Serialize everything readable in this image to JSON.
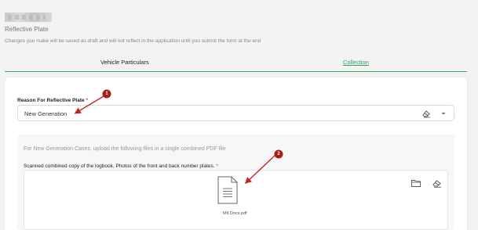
{
  "header": {
    "subtitle": "Reflective Plate",
    "draft_note": "Changes you make will be saved as draft and will not reflect in the application until you submit the form at the end"
  },
  "tabs": [
    {
      "label": "Vehicle Particulars",
      "active": true
    },
    {
      "label": "Collection",
      "active": false
    }
  ],
  "form": {
    "reason_label": "Reason For Reflective Plate",
    "required_mark": "*",
    "reason_value": "New Generation",
    "upload_instruction": "For New Generation Cases, upload the following files in a single combined PDF file",
    "upload_label": "Scanned combined copy of the logbook, Photos of the front and back number plates.",
    "file_name": "Mit Docs.pdf"
  },
  "annotations": [
    {
      "number": "1"
    },
    {
      "number": "2"
    }
  ],
  "icons": {
    "clear": "eraser-icon",
    "dropdown": "chevron-down-icon",
    "document": "document-icon",
    "browse": "folder-icon",
    "remove": "eraser-icon"
  },
  "colors": {
    "accent": "#3aa866",
    "link": "#2e9e5c",
    "annotation": "#c0281f",
    "required": "#d33333"
  }
}
